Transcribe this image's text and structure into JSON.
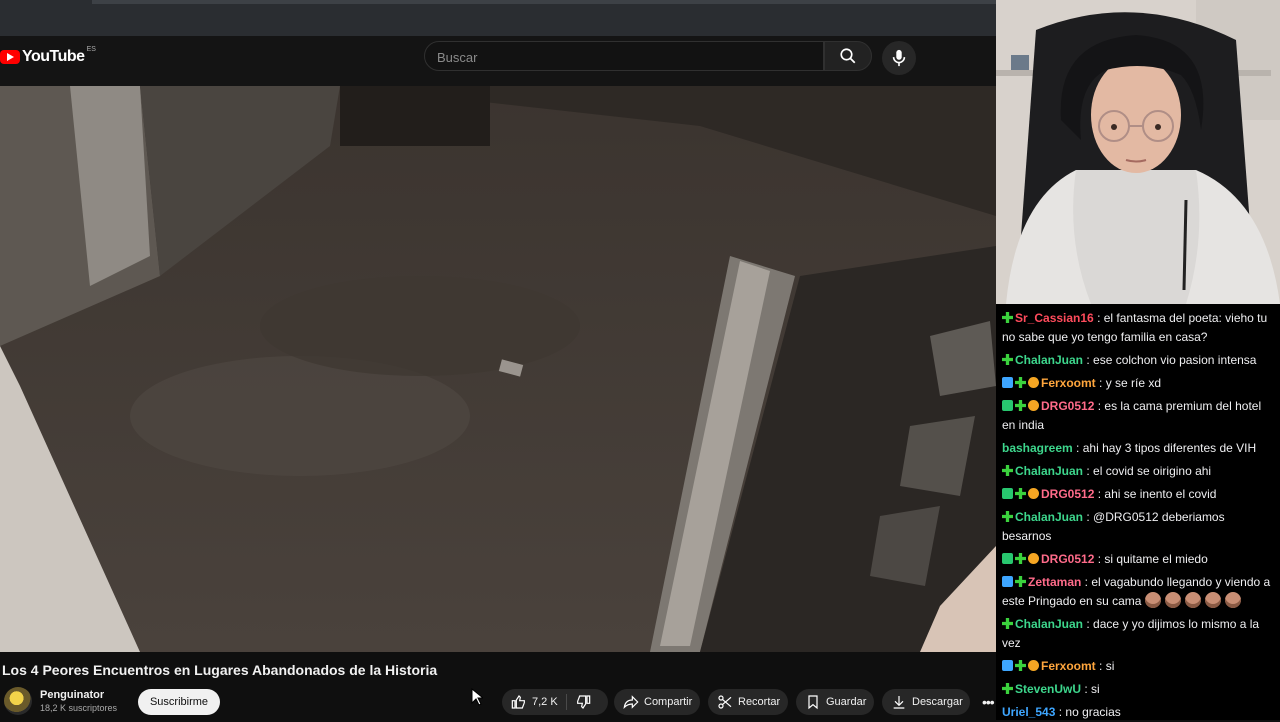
{
  "youtube": {
    "logo_text": "YouTube",
    "logo_region": "ES",
    "search_placeholder": "Buscar"
  },
  "video": {
    "title": "Los 4 Peores Encuentros en Lugares Abandonados de la Historia",
    "channel_name": "Penguinator",
    "subscribers": "18,2 K suscriptores",
    "subscribe_label": "Suscribirme",
    "likes": "7,2 K",
    "share_label": "Compartir",
    "clip_label": "Recortar",
    "save_label": "Guardar",
    "download_label": "Descargar"
  },
  "chat": {
    "messages": [
      {
        "badges": [
          "plus"
        ],
        "user": "Sr_Cassian16",
        "color": "#ff4b5c",
        "text": "el fantasma del poeta: vieho tu no sabe que yo tengo familia en casa?"
      },
      {
        "badges": [
          "plus"
        ],
        "user": "ChalanJuan",
        "color": "#3dd68c",
        "text": "ese colchon vio pasion intensa"
      },
      {
        "badges": [
          "prime",
          "plus",
          "coin"
        ],
        "user": "Ferxoomt",
        "color": "#ffa63d",
        "text": "y se ríe xd"
      },
      {
        "badges": [
          "cube",
          "plus",
          "coin"
        ],
        "user": "DRG0512",
        "color": "#ff6b8a",
        "text": "es la cama premium del hotel en india"
      },
      {
        "badges": [],
        "user": "bashagreem",
        "color": "#3dd68c",
        "text": "ahi hay 3 tipos diferentes de VIH"
      },
      {
        "badges": [
          "plus"
        ],
        "user": "ChalanJuan",
        "color": "#3dd68c",
        "text": "el covid se oirigino ahi"
      },
      {
        "badges": [
          "cube",
          "plus",
          "coin"
        ],
        "user": "DRG0512",
        "color": "#ff6b8a",
        "text": "ahi se inento el covid"
      },
      {
        "badges": [
          "plus"
        ],
        "user": "ChalanJuan",
        "color": "#3dd68c",
        "text": "@DRG0512 deberiamos besarnos"
      },
      {
        "badges": [
          "cube",
          "plus",
          "coin"
        ],
        "user": "DRG0512",
        "color": "#ff6b8a",
        "text": "si quitame el miedo"
      },
      {
        "badges": [
          "prime",
          "plus"
        ],
        "user": "Zettaman",
        "color": "#ff6b8a",
        "text": "el vagabundo llegando y viendo a este Pringado en su cama",
        "emotes": 5
      },
      {
        "badges": [
          "plus"
        ],
        "user": "ChalanJuan",
        "color": "#3dd68c",
        "text": "dace y yo dijimos lo mismo a la vez"
      },
      {
        "badges": [
          "prime",
          "plus",
          "coin"
        ],
        "user": "Ferxoomt",
        "color": "#ffa63d",
        "text": "si"
      },
      {
        "badges": [
          "plus"
        ],
        "user": "StevenUwU",
        "color": "#3dd68c",
        "text": "si"
      },
      {
        "badges": [],
        "user": "Uriel_543",
        "color": "#3ea6ff",
        "text": "no gracias"
      }
    ]
  }
}
